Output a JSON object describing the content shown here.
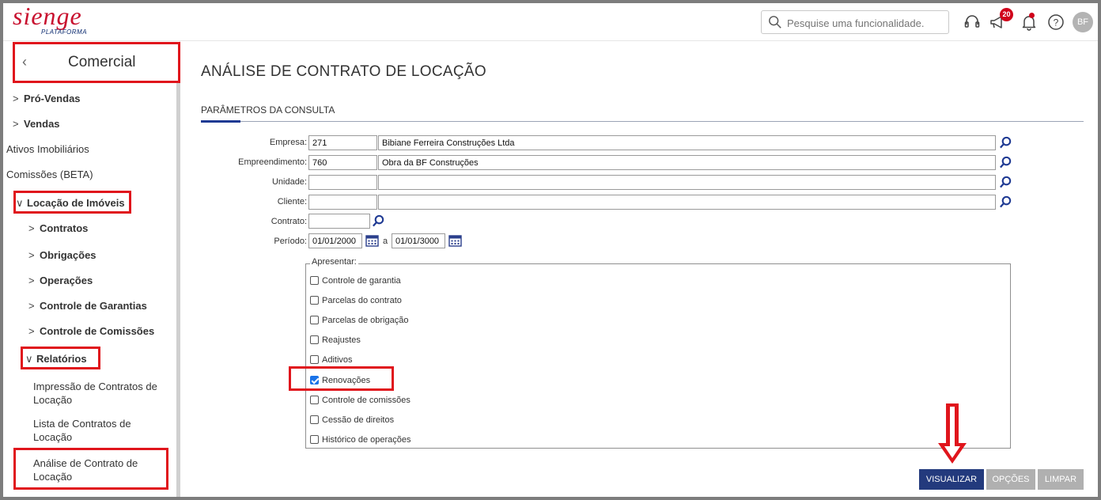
{
  "header": {
    "logo_text": "sienge",
    "logo_sub": "PLATAFORMA",
    "search_placeholder": "Pesquise uma funcionalidade.",
    "notification_count": "20",
    "avatar_initials": "BF"
  },
  "sidebar": {
    "module_title": "Comercial",
    "items": [
      {
        "label": "Pró-Vendas"
      },
      {
        "label": "Vendas"
      },
      {
        "label": "Ativos Imobiliários"
      },
      {
        "label": "Comissões (BETA)"
      },
      {
        "label": "Locação de Imóveis"
      },
      {
        "label": "Contratos"
      },
      {
        "label": "Obrigações"
      },
      {
        "label": "Operações"
      },
      {
        "label": "Controle de Garantias"
      },
      {
        "label": "Controle de Comissões"
      },
      {
        "label": "Relatórios"
      },
      {
        "label": "Impressão de Contratos de Locação"
      },
      {
        "label": "Lista de Contratos de Locação"
      },
      {
        "label": "Análise de Contrato de Locação"
      }
    ]
  },
  "main": {
    "page_title": "ANÁLISE DE CONTRATO DE LOCAÇÃO",
    "section_title": "PARÂMETROS DA CONSULTA",
    "form": {
      "empresa_label": "Empresa:",
      "empresa_code": "271",
      "empresa_name": "Bibiane Ferreira Construções Ltda",
      "empreendimento_label": "Empreendimento:",
      "empreendimento_code": "760",
      "empreendimento_name": "Obra da BF Construções",
      "unidade_label": "Unidade:",
      "unidade_code": "",
      "unidade_name": "",
      "cliente_label": "Cliente:",
      "cliente_code": "",
      "cliente_name": "",
      "contrato_label": "Contrato:",
      "contrato_value": "",
      "periodo_label": "Período:",
      "periodo_start": "01/01/2000",
      "periodo_sep": "a",
      "periodo_end": "01/01/3000"
    },
    "apresentar": {
      "legend": "Apresentar:",
      "options": [
        {
          "label": "Controle de garantia",
          "checked": false
        },
        {
          "label": "Parcelas do contrato",
          "checked": false
        },
        {
          "label": "Parcelas de obrigação",
          "checked": false
        },
        {
          "label": "Reajustes",
          "checked": false
        },
        {
          "label": "Aditivos",
          "checked": false
        },
        {
          "label": "Renovações",
          "checked": true
        },
        {
          "label": "Controle de comissões",
          "checked": false
        },
        {
          "label": "Cessão de direitos",
          "checked": false
        },
        {
          "label": "Histórico de operações",
          "checked": false
        }
      ]
    },
    "buttons": {
      "visualizar": "VISUALIZAR",
      "opcoes": "OPÇÕES",
      "limpar": "LIMPAR"
    }
  },
  "colors": {
    "brand_red": "#c8102e",
    "primary_button": "#233a7d",
    "highlight_red": "#e0151c",
    "disabled_button": "#b0b0b0"
  }
}
